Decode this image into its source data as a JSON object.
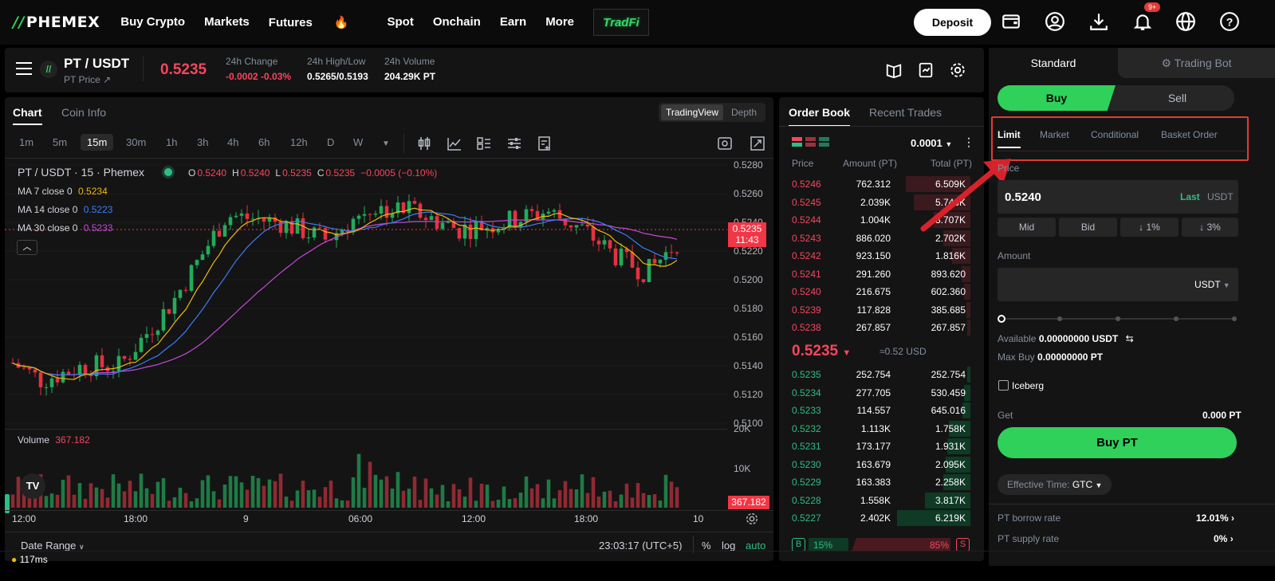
{
  "topnav": {
    "logo": "PHEMEX",
    "items": [
      "Buy Crypto",
      "Markets",
      "Futures",
      "Spot",
      "Onchain",
      "Earn",
      "More"
    ],
    "tradfi": "TradFi",
    "deposit": "Deposit",
    "notif_badge": "9+"
  },
  "ticker": {
    "pair": "PT / USDT",
    "subtitle": "PT Price ↗",
    "price": "0.5235",
    "change_label": "24h Change",
    "change_value": "-0.0002 -0.03%",
    "hl_label": "24h High/Low",
    "hl_value": "0.5265/0.5193",
    "vol_label": "24h Volume",
    "vol_value": "204.29K PT"
  },
  "chart_tabs": {
    "chart": "Chart",
    "coininfo": "Coin Info",
    "tradingview": "TradingView",
    "depth": "Depth"
  },
  "timeframes": [
    "1m",
    "5m",
    "15m",
    "30m",
    "1h",
    "3h",
    "4h",
    "6h",
    "12h",
    "D",
    "W"
  ],
  "chart_legend": {
    "title": "PT / USDT · 15 · Phemex",
    "ohlc_o_l": "O",
    "ohlc_o": "0.5240",
    "ohlc_h_l": "H",
    "ohlc_h": "0.5240",
    "ohlc_l_l": "L",
    "ohlc_l": "0.5235",
    "ohlc_c_l": "C",
    "ohlc_c": "0.5235",
    "ohlc_chg": "−0.0005 (−0.10%)",
    "ma7": "MA 7 close 0",
    "ma7_v": "0.5234",
    "ma14": "MA 14 close 0",
    "ma14_v": "0.5223",
    "ma30": "MA 30 close 0",
    "ma30_v": "0.5233",
    "volume": "Volume",
    "volume_v": "367.182",
    "price_tag": "0.5235",
    "price_tag_time": "11:43",
    "vol_tag": "367.182",
    "date_range": "Date Range",
    "clock": "23:03:17 (UTC+5)",
    "pct": "%",
    "log": "log",
    "auto": "auto"
  },
  "price_axis": [
    "0.5280",
    "0.5260",
    "0.5240",
    "0.5220",
    "0.5200",
    "0.5180",
    "0.5160",
    "0.5140",
    "0.5120",
    "0.5100"
  ],
  "vol_axis": [
    "20K",
    "10K"
  ],
  "time_axis": [
    "12:00",
    "18:00",
    "9",
    "06:00",
    "12:00",
    "18:00",
    "10"
  ],
  "orderbook": {
    "tab1": "Order Book",
    "tab2": "Recent Trades",
    "precision": "0.0001",
    "h_price": "Price",
    "h_amount": "Amount (PT)",
    "h_total": "Total (PT)",
    "asks": [
      {
        "p": "0.5246",
        "a": "762.312",
        "t": "6.509K",
        "d": 0.85
      },
      {
        "p": "0.5245",
        "a": "2.039K",
        "t": "5.746K",
        "d": 0.75
      },
      {
        "p": "0.5244",
        "a": "1.004K",
        "t": "3.707K",
        "d": 0.48
      },
      {
        "p": "0.5243",
        "a": "886.020",
        "t": "2.702K",
        "d": 0.36
      },
      {
        "p": "0.5242",
        "a": "923.150",
        "t": "1.816K",
        "d": 0.24
      },
      {
        "p": "0.5241",
        "a": "291.260",
        "t": "893.620",
        "d": 0.12
      },
      {
        "p": "0.5240",
        "a": "216.675",
        "t": "602.360",
        "d": 0.08
      },
      {
        "p": "0.5239",
        "a": "117.828",
        "t": "385.685",
        "d": 0.05
      },
      {
        "p": "0.5238",
        "a": "267.857",
        "t": "267.857",
        "d": 0.04
      }
    ],
    "mid": "0.5235",
    "mid_usd": "≈0.52 USD",
    "bids": [
      {
        "p": "0.5235",
        "a": "252.754",
        "t": "252.754",
        "d": 0.04
      },
      {
        "p": "0.5234",
        "a": "277.705",
        "t": "530.459",
        "d": 0.08
      },
      {
        "p": "0.5233",
        "a": "114.557",
        "t": "645.016",
        "d": 0.1
      },
      {
        "p": "0.5232",
        "a": "1.113K",
        "t": "1.758K",
        "d": 0.28
      },
      {
        "p": "0.5231",
        "a": "173.177",
        "t": "1.931K",
        "d": 0.3
      },
      {
        "p": "0.5230",
        "a": "163.679",
        "t": "2.095K",
        "d": 0.33
      },
      {
        "p": "0.5229",
        "a": "163.383",
        "t": "2.258K",
        "d": 0.36
      },
      {
        "p": "0.5228",
        "a": "1.558K",
        "t": "3.817K",
        "d": 0.6
      },
      {
        "p": "0.5227",
        "a": "2.402K",
        "t": "6.219K",
        "d": 0.97
      }
    ],
    "b_label": "B",
    "b_pct": "15%",
    "s_pct": "85%",
    "s_label": "S"
  },
  "trade": {
    "tab_standard": "Standard",
    "tab_bot": "Trading Bot",
    "buy": "Buy",
    "sell": "Sell",
    "order_types": [
      "Limit",
      "Market",
      "Conditional",
      "Basket Order"
    ],
    "price_label": "Price",
    "price_value": "0.5240",
    "last": "Last",
    "usdt": "USDT",
    "quick": [
      "Mid",
      "Bid",
      "↓ 1%",
      "↓ 3%"
    ],
    "amount_label": "Amount",
    "amount_unit": "USDT",
    "available_label": "Available",
    "available_value": "0.00000000 USDT",
    "maxbuy_label": "Max Buy",
    "maxbuy_value": "0.00000000 PT",
    "iceberg": "Iceberg",
    "get_label": "Get",
    "get_value": "0.000 PT",
    "buy_btn": "Buy PT",
    "eff_label": "Effective Time:",
    "eff_value": "GTC",
    "borrow_label": "PT borrow rate",
    "borrow_value": "12.01%",
    "supply_label": "PT supply rate",
    "supply_value": "0%"
  },
  "status": {
    "latency": "117ms"
  },
  "chart_data": {
    "type": "candlestick",
    "ylim": [
      0.51,
      0.528
    ],
    "last_price": 0.5235
  }
}
